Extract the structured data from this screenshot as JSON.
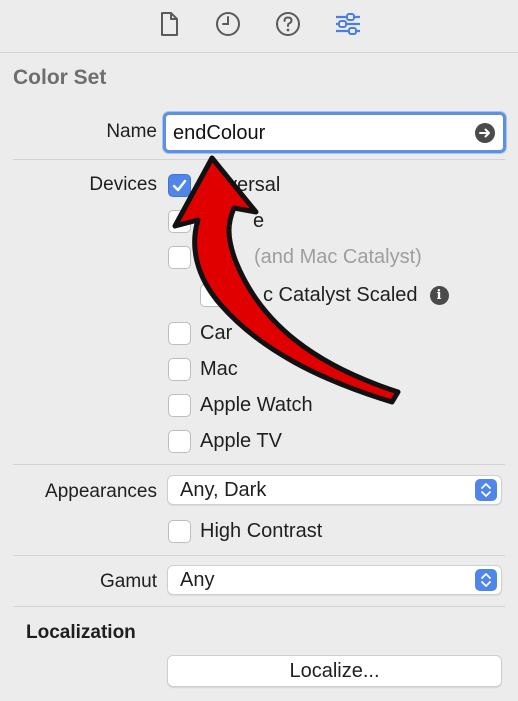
{
  "toolbar": {
    "icons": [
      "file-icon",
      "clock-icon",
      "help-icon",
      "sliders-icon"
    ],
    "accent": "#4a7fe0"
  },
  "section_title": "Color Set",
  "name_row": {
    "label": "Name",
    "value": "endColour"
  },
  "devices": {
    "label": "Devices",
    "items": [
      {
        "label": "versal",
        "checked": true,
        "dim": false
      },
      {
        "label": "e",
        "checked": false,
        "dim": false
      },
      {
        "label": "(and Mac Catalyst)",
        "checked": false,
        "dim": true
      },
      {
        "label": "c Catalyst Scaled",
        "checked": false,
        "dim": false
      },
      {
        "label": "Car",
        "checked": false,
        "dim": false
      },
      {
        "label": "Mac",
        "checked": false,
        "dim": false
      },
      {
        "label": "Apple Watch",
        "checked": false,
        "dim": false
      },
      {
        "label": "Apple TV",
        "checked": false,
        "dim": false
      }
    ]
  },
  "appearances": {
    "label": "Appearances",
    "value": "Any, Dark",
    "high_contrast_label": "High Contrast",
    "high_contrast_checked": false
  },
  "gamut": {
    "label": "Gamut",
    "value": "Any"
  },
  "localization": {
    "title": "Localization",
    "button_label": "Localize..."
  },
  "colors": {
    "checkbox_checked": "#4f86e8",
    "focus_ring": "#5d8fe3",
    "annotation_arrow": "#e00000"
  }
}
